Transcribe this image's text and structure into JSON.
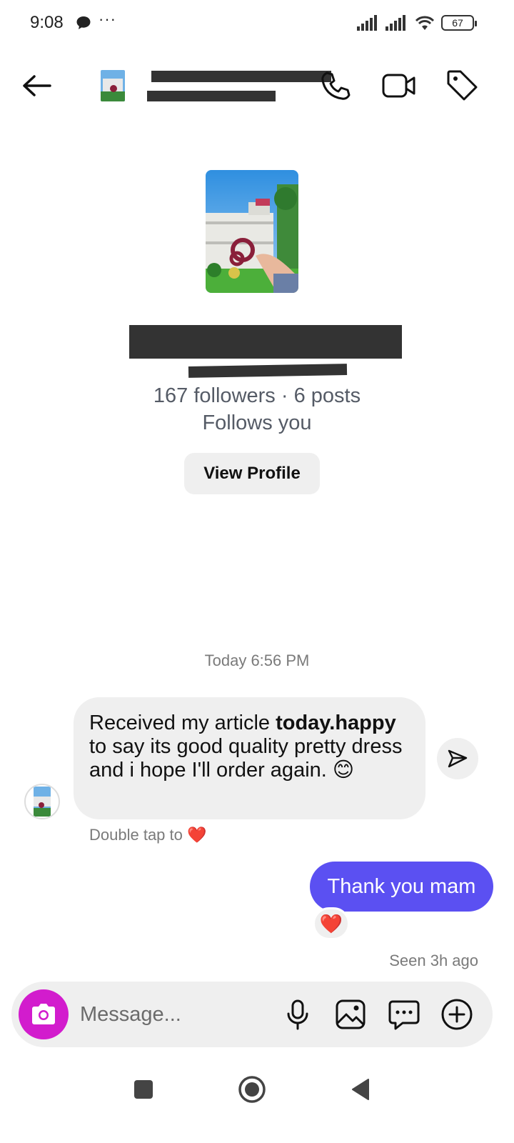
{
  "status_bar": {
    "time": "9:08",
    "dots": "···",
    "battery": "67"
  },
  "header": {
    "icons": [
      "back-arrow-icon",
      "phone-icon",
      "video-camera-icon",
      "tag-icon"
    ]
  },
  "profile": {
    "stats": "167 followers · 6 posts",
    "follows_you": "Follows you",
    "view_profile_label": "View Profile"
  },
  "conversation": {
    "timestamp": "Today 6:56 PM",
    "incoming": {
      "text_before": "Received my article ",
      "text_bold": "today.happy",
      "text_after": " to say its good quality pretty dress and i hope I'll order again. 😊",
      "hint": "Double tap to ❤️"
    },
    "outgoing": {
      "text": "Thank you mam",
      "reaction": "❤️",
      "seen": "Seen 3h ago"
    }
  },
  "composer": {
    "placeholder": "Message..."
  },
  "colors": {
    "accent_bubble": "#5b50f2",
    "camera_button": "#d21ccd",
    "bubble_gray": "#efefef"
  }
}
